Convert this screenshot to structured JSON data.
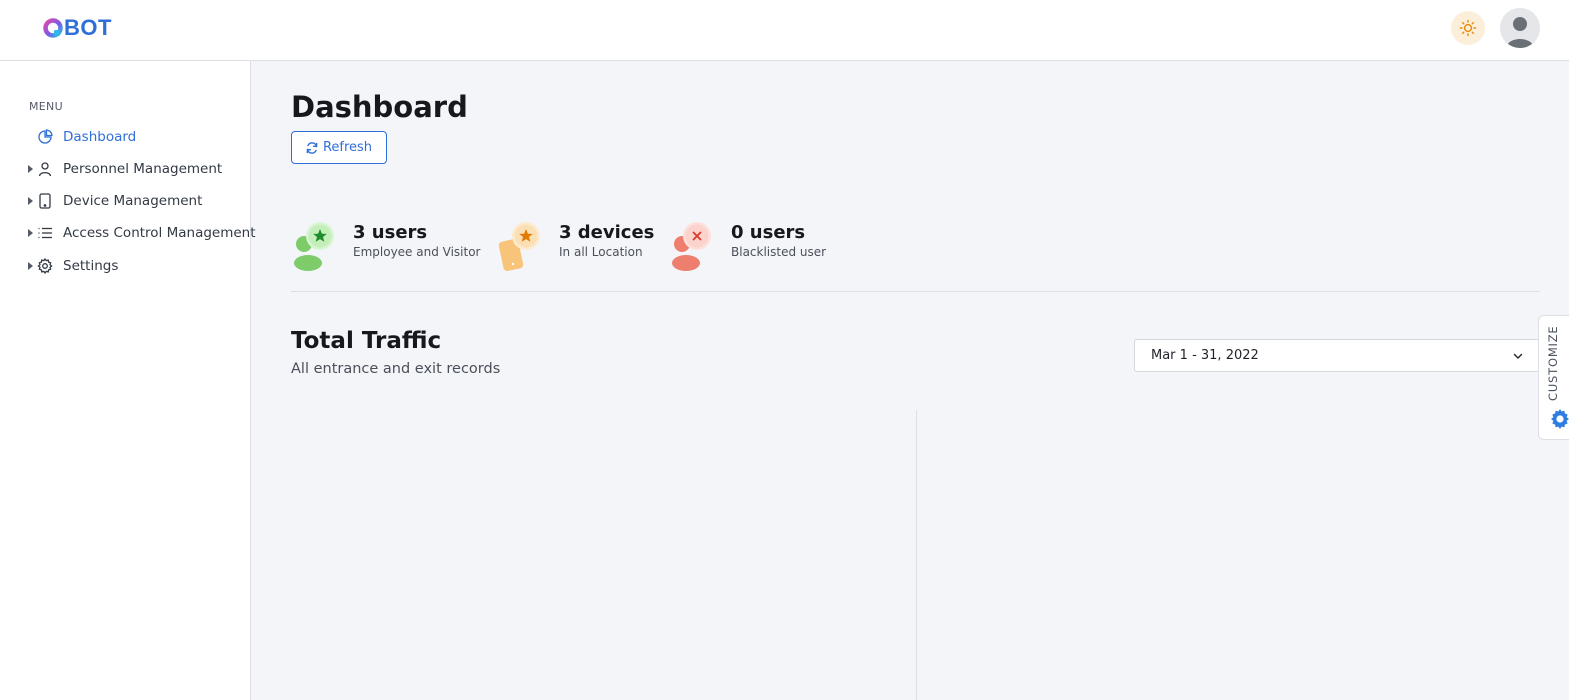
{
  "header": {
    "logo_text": "BOT",
    "theme_toggle_icon": "sun-icon",
    "avatar_icon": "user-avatar-icon"
  },
  "sidebar": {
    "menu_label": "MENU",
    "items": [
      {
        "label": "Dashboard",
        "icon": "pie-chart-icon",
        "active": true,
        "expandable": false
      },
      {
        "label": "Personnel Management",
        "icon": "user-icon",
        "active": false,
        "expandable": true
      },
      {
        "label": "Device Management",
        "icon": "tablet-icon",
        "active": false,
        "expandable": true
      },
      {
        "label": "Access Control Management",
        "icon": "list-icon",
        "active": false,
        "expandable": true
      },
      {
        "label": "Settings",
        "icon": "gear-icon",
        "active": false,
        "expandable": true
      }
    ]
  },
  "main": {
    "title": "Dashboard",
    "refresh_label": "Refresh",
    "stats": [
      {
        "value": "3 users",
        "label": "Employee and Visitor",
        "icon": "user-star-icon",
        "color": "#21a336"
      },
      {
        "value": "3 devices",
        "label": "In all Location",
        "icon": "device-star-icon",
        "color": "#f08c00"
      },
      {
        "value": "0 users",
        "label": "Blacklisted user",
        "icon": "user-blocked-icon",
        "color": "#e5483a"
      }
    ],
    "traffic": {
      "title": "Total Traffic",
      "subtitle": "All entrance and exit records",
      "date_range": "Mar 1 - 31, 2022"
    },
    "customize_label": "CUSTOMIZE"
  },
  "colors": {
    "accent": "#2f6fd8",
    "background": "#f4f5f9"
  }
}
